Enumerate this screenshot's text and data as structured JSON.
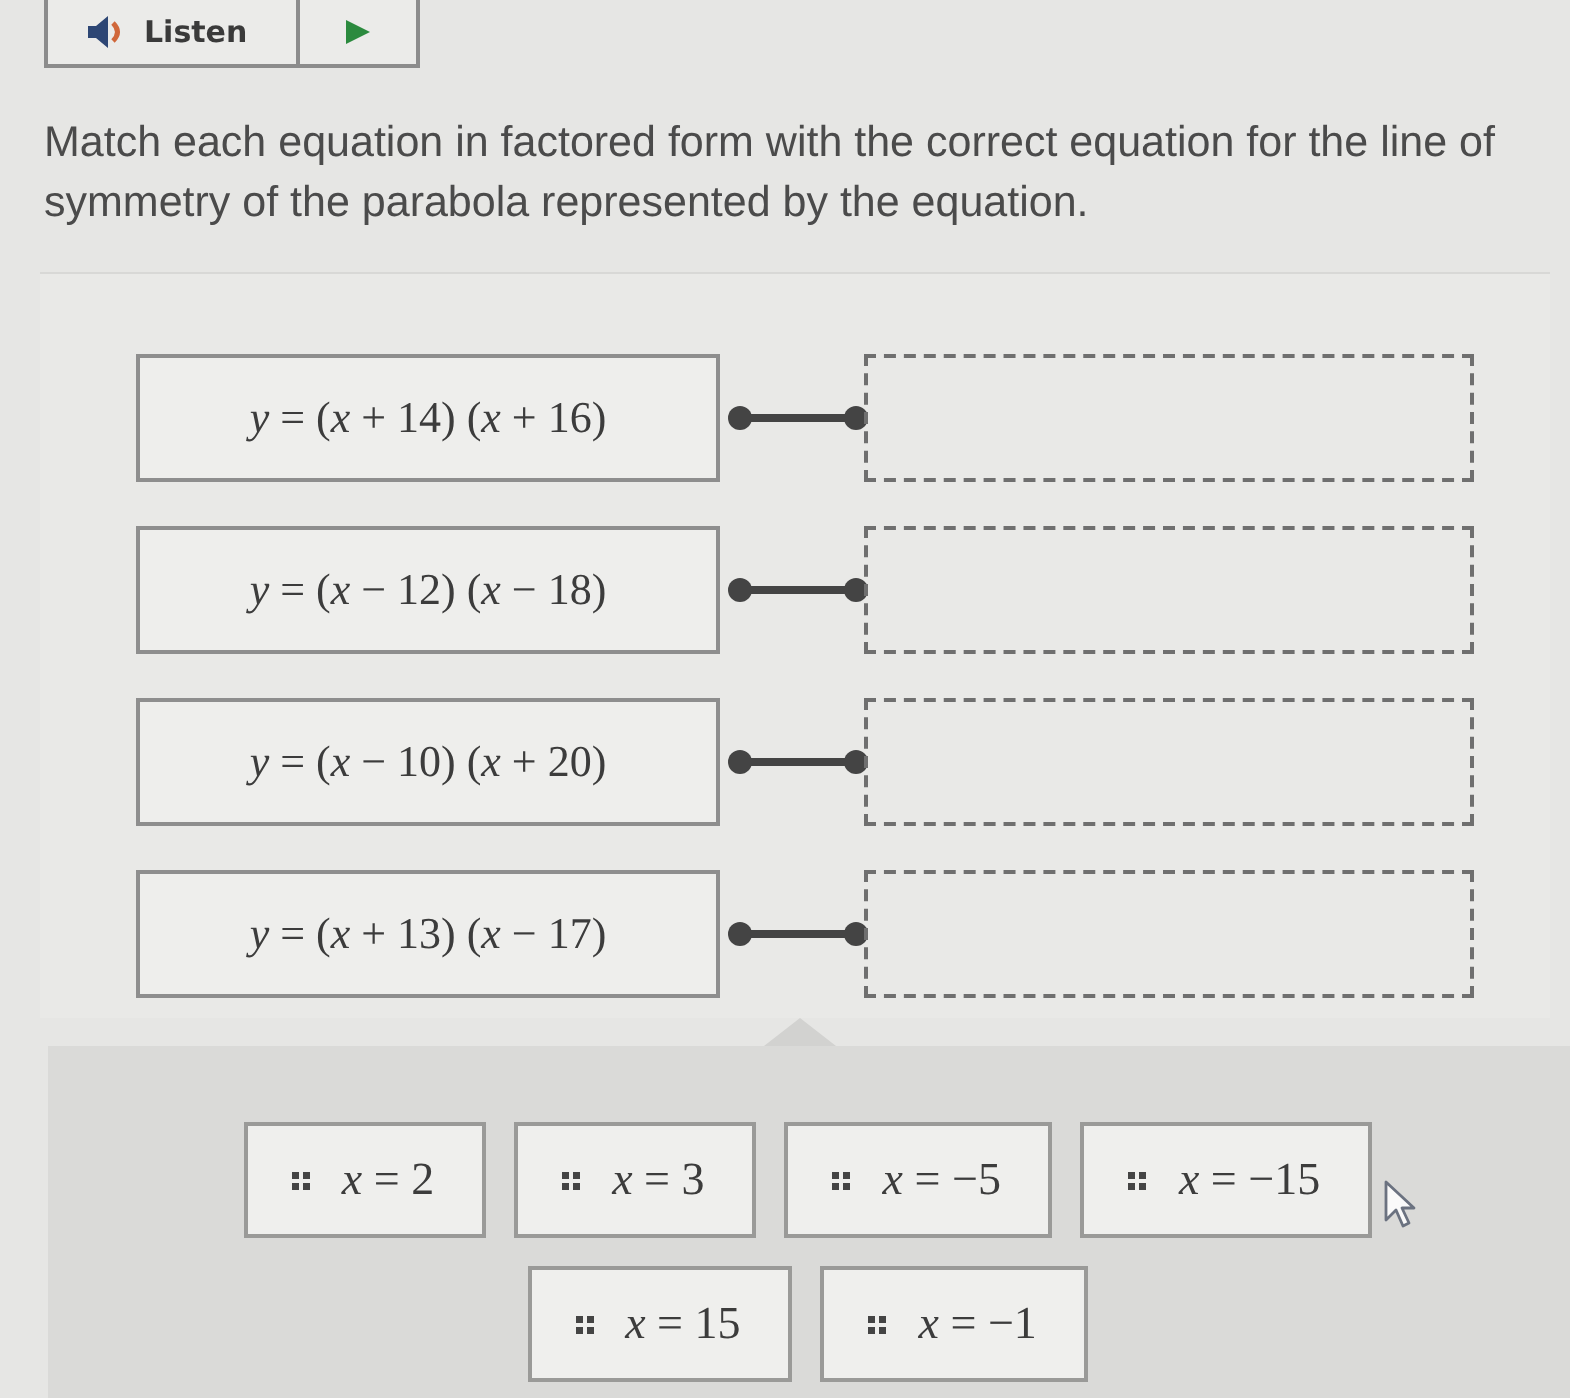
{
  "toolbar": {
    "listen_label": "Listen"
  },
  "instructions": "Match each equation in factored form with the correct equation for the line of symmetry of the parabola represented by the equation.",
  "equations": [
    {
      "text": "*y* = (*x* + 14) (*x* + 16)"
    },
    {
      "text": "*y* = (*x* − 12) (*x* − 18)"
    },
    {
      "text": "*y* = (*x* − 10) (*x* + 20)"
    },
    {
      "text": "*y* = (*x* + 13) (*x* − 17)"
    }
  ],
  "answer_tiles": [
    {
      "text": "*x* = 2"
    },
    {
      "text": "*x* = 3"
    },
    {
      "text": "*x* = −5"
    },
    {
      "text": "*x* = −15"
    },
    {
      "text": "*x* = 15"
    },
    {
      "text": "*x* = −1"
    }
  ]
}
